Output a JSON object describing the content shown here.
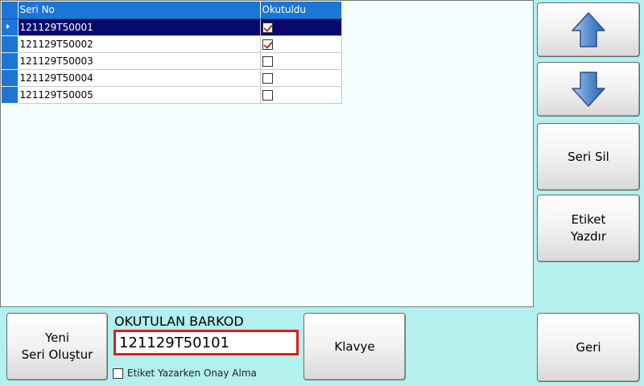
{
  "grid": {
    "columns": [
      "Seri No",
      "Okutuldu"
    ],
    "rows": [
      {
        "serial": "121129T50001",
        "read": true,
        "selected": true
      },
      {
        "serial": "121129T50002",
        "read": true,
        "selected": false
      },
      {
        "serial": "121129T50003",
        "read": false,
        "selected": false
      },
      {
        "serial": "121129T50004",
        "read": false,
        "selected": false
      },
      {
        "serial": "121129T50005",
        "read": false,
        "selected": false
      }
    ]
  },
  "buttons": {
    "seri_sil": "Seri Sil",
    "etiket_line1": "Etiket",
    "etiket_line2": "Yazdır",
    "geri": "Geri",
    "yeni_line1": "Yeni",
    "yeni_line2": "Seri Oluştur",
    "klavye": "Klavye"
  },
  "barkod": {
    "label": "OKUTULAN BARKOD",
    "value": "121129T50101"
  },
  "confirm": {
    "label": "Etiket Yazarken Onay Alma",
    "checked": false
  },
  "icons": {
    "up": "arrow-up-icon",
    "down": "arrow-down-icon"
  },
  "colors": {
    "background": "#b3f0ee",
    "header": "#1c76d6",
    "selected_row": "#0a0a6e",
    "input_border": "#e01b1b"
  }
}
